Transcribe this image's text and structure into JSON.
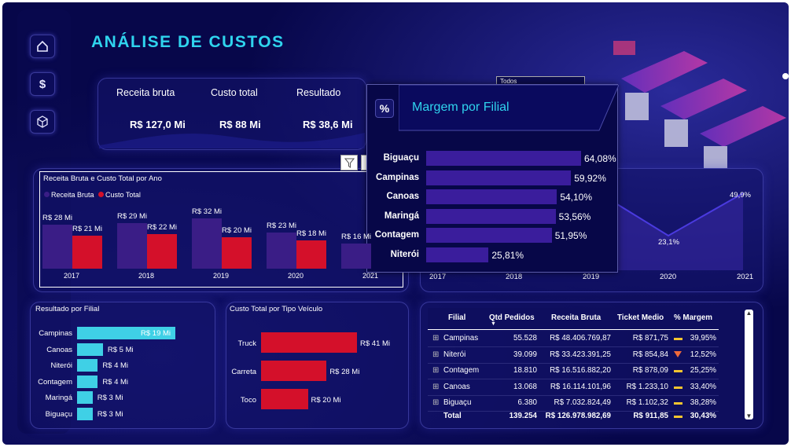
{
  "header": {
    "title": "ANÁLISE DE CUSTOS"
  },
  "nav": {
    "home_icon": "⌂",
    "dollar_icon": "$",
    "box_icon": "⬡"
  },
  "kpis": [
    {
      "label": "Receita bruta",
      "value": "R$ 127,0 Mi"
    },
    {
      "label": "Custo total",
      "value": "R$ 88 Mi"
    },
    {
      "label": "Resultado",
      "value": "R$ 38,6 Mi"
    }
  ],
  "slicer": {
    "label": "Todos"
  },
  "year_chart": {
    "title": "Receita Bruta e Custo Total por Ano",
    "legend": [
      "Receita Bruta",
      "Custo Total"
    ],
    "colors": {
      "receita": "#3a1d86",
      "custo": "#d4102a"
    },
    "chart_data": {
      "type": "bar",
      "categories": [
        "2017",
        "2018",
        "2019",
        "2020",
        "2021"
      ],
      "series": [
        {
          "name": "Receita Bruta",
          "values": [
            28,
            29,
            32,
            23,
            16
          ],
          "labels": [
            "R$ 28 Mi",
            "R$ 29 Mi",
            "R$ 32 Mi",
            "R$ 23 Mi",
            "R$ 16 Mi"
          ]
        },
        {
          "name": "Custo Total",
          "values": [
            21,
            22,
            20,
            18,
            null
          ],
          "labels": [
            "R$ 21 Mi",
            "R$ 22 Mi",
            "R$ 20 Mi",
            "R$ 18 Mi",
            ""
          ]
        }
      ]
    }
  },
  "margin_line": {
    "chart_data": {
      "type": "area",
      "categories": [
        "2017",
        "2018",
        "2019",
        "2020",
        "2021"
      ],
      "visible_labels": [
        {
          "x": "2020",
          "label": "23,1%"
        },
        {
          "x": "2021",
          "label": "49,9%"
        }
      ]
    }
  },
  "result_filial": {
    "title": "Resultado por Filial",
    "color": "#3fd0e6",
    "chart_data": {
      "type": "bar",
      "categories": [
        "Campinas",
        "Canoas",
        "Niterói",
        "Contagem",
        "Maringá",
        "Biguaçu"
      ],
      "values": [
        19,
        5,
        4,
        4,
        3,
        3
      ],
      "labels": [
        "R$ 19 Mi",
        "R$ 5 Mi",
        "R$ 4 Mi",
        "R$ 4 Mi",
        "R$ 3 Mi",
        "R$ 3 Mi"
      ]
    }
  },
  "custo_veiculo": {
    "title": "Custo Total por Tipo Veículo",
    "color": "#d4102a",
    "chart_data": {
      "type": "bar",
      "categories": [
        "Truck",
        "Carreta",
        "Toco"
      ],
      "values": [
        41,
        28,
        20
      ],
      "labels": [
        "R$ 41 Mi",
        "R$ 28 Mi",
        "R$ 20 Mi"
      ]
    }
  },
  "table": {
    "headers": [
      "Filial",
      "Qtd Pedidos",
      "Receita Bruta",
      "Ticket Medio",
      "% Margem"
    ],
    "rows": [
      {
        "filial": "Campinas",
        "qtd": "55.528",
        "receita": "R$ 48.406.769,87",
        "ticket": "R$ 871,75",
        "margem": "39,95%",
        "ind": "bar"
      },
      {
        "filial": "Niterói",
        "qtd": "39.099",
        "receita": "R$ 33.423.391,25",
        "ticket": "R$ 854,84",
        "margem": "12,52%",
        "ind": "down"
      },
      {
        "filial": "Contagem",
        "qtd": "18.810",
        "receita": "R$ 16.516.882,20",
        "ticket": "R$ 878,09",
        "margem": "25,25%",
        "ind": "bar"
      },
      {
        "filial": "Canoas",
        "qtd": "13.068",
        "receita": "R$ 16.114.101,96",
        "ticket": "R$ 1.233,10",
        "margem": "33,40%",
        "ind": "bar"
      },
      {
        "filial": "Biguaçu",
        "qtd": "6.380",
        "receita": "R$ 7.032.824,49",
        "ticket": "R$ 1.102,32",
        "margem": "38,28%",
        "ind": "bar"
      }
    ],
    "total": {
      "filial": "Total",
      "qtd": "139.254",
      "receita": "R$ 126.978.982,69",
      "ticket": "R$ 911,85",
      "margem": "30,43%"
    }
  },
  "popup": {
    "title": "Margem por Filial",
    "icon": "%",
    "color": "#3a1d9c",
    "chart_data": {
      "type": "bar",
      "categories": [
        "Biguaçu",
        "Campinas",
        "Canoas",
        "Maringá",
        "Contagem",
        "Niterói"
      ],
      "values": [
        64.08,
        59.92,
        54.1,
        53.56,
        51.95,
        25.81
      ],
      "labels": [
        "64,08%",
        "59,92%",
        "54,10%",
        "53,56%",
        "51,95%",
        "25,81%"
      ]
    }
  }
}
